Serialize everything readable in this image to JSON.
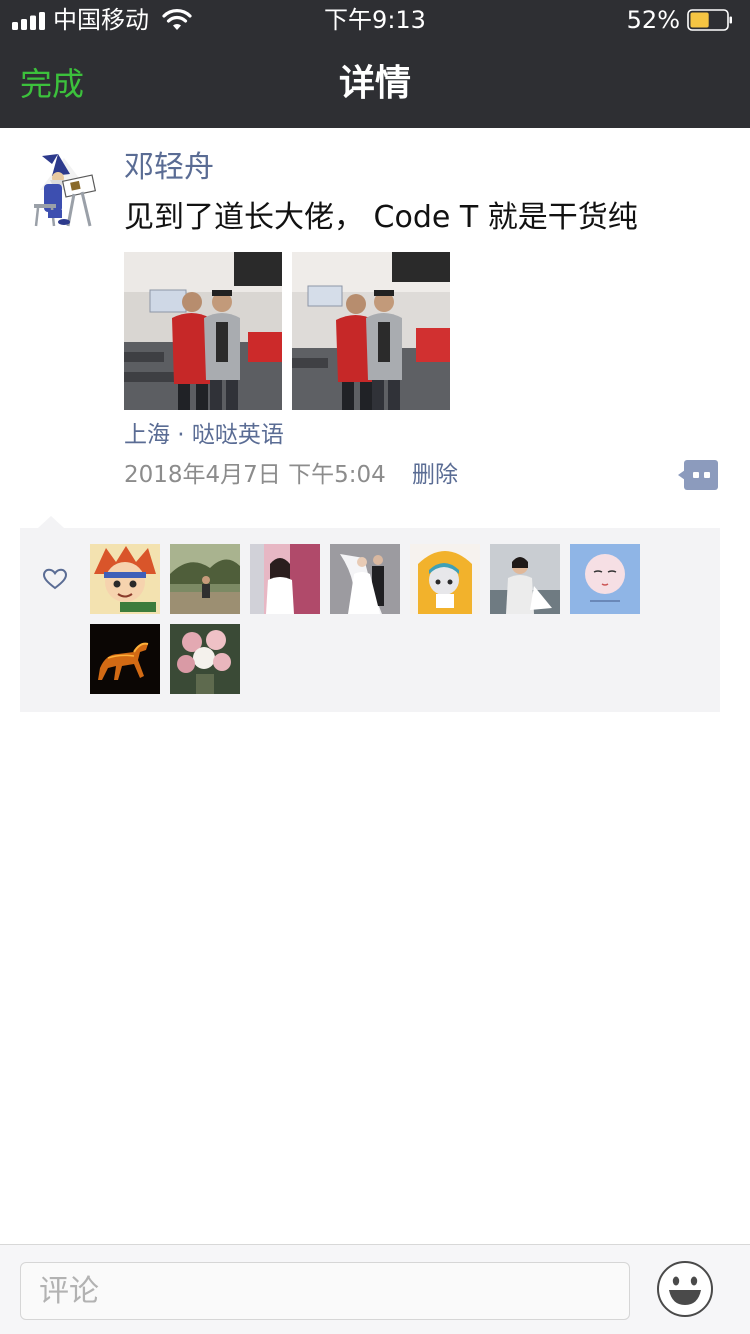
{
  "status_bar": {
    "carrier": "中国移动",
    "time": "下午9:13",
    "battery_percent": "52%",
    "battery_level": 0.52,
    "icons": [
      "signal-icon",
      "wifi-icon",
      "battery-icon"
    ]
  },
  "nav": {
    "done_label": "完成",
    "title": "详情"
  },
  "post": {
    "author": "邓轻舟",
    "text": "见到了道长大佬， Code T 就是干货纯",
    "photo_count": 2,
    "location": "上海 · 哒哒英语",
    "time": "2018年4月7日 下午5:04",
    "delete_label": "删除",
    "more_icon": "comment-more-icon"
  },
  "likes": {
    "icon": "heart-icon",
    "likers_count": 9
  },
  "comment_bar": {
    "placeholder": "评论",
    "emoji_icon": "emoji-icon"
  },
  "colors": {
    "nav_background": "#2e2f33",
    "done_green": "#3cc13c",
    "link_blue": "#5a6c94",
    "likes_background": "#f3f3f5"
  }
}
